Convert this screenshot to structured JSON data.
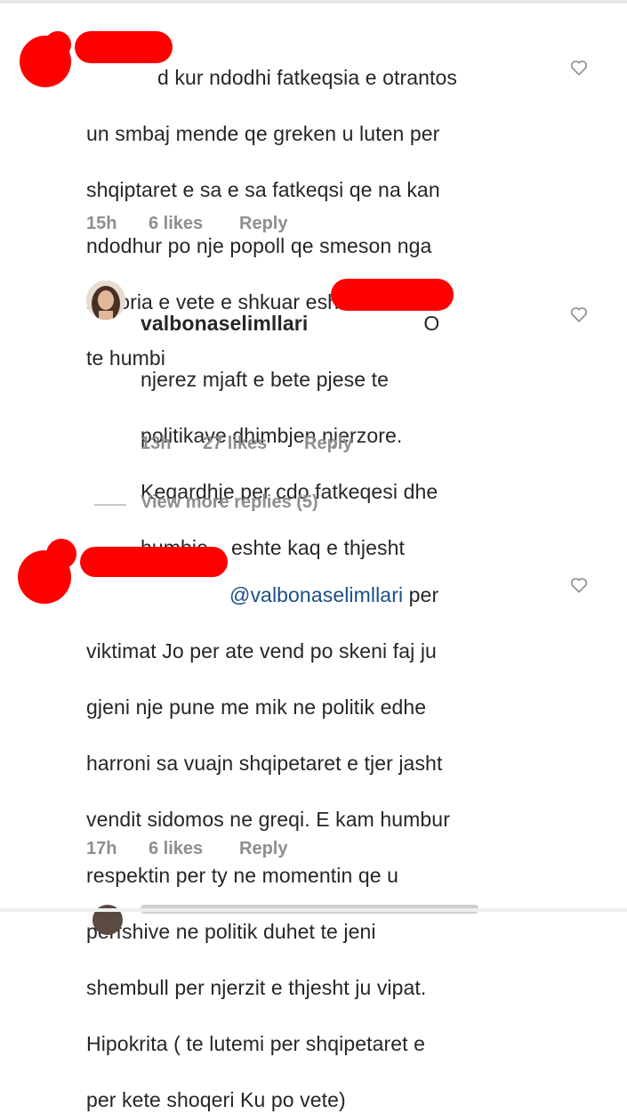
{
  "comments": [
    {
      "username": "",
      "text_lines": [
        "d kur ndodhi fatkeqsia e otrantos",
        "un smbaj mende qe greken u luten per",
        "shqiptaret e sa e sa fatkeqsi qe na kan",
        "ndodhur po nje popoll qe smeson nga",
        "historia e vete e shkuar esht i destinuar",
        "te humbi"
      ],
      "time": "15h",
      "likes": "6 likes",
      "reply": "Reply",
      "redacted": true
    },
    {
      "username": "valbonaselimllari",
      "text_tail": "O",
      "text_lines": [
        "njerez mjaft e bete pjese te",
        "politikave dhimbjen njerzore.",
        "Keqardhje per cdo fatkeqesi dhe",
        "humbje... eshte kaq e thjesht"
      ],
      "time": "13h",
      "likes": "27 likes",
      "reply": "Reply",
      "avatar": "profile-photo"
    },
    {
      "username": "",
      "mention": "@valbonaselimllari",
      "mention_tail": " per",
      "text_lines": [
        "viktimat Jo per ate vend po skeni faj ju",
        "gjeni nje pune me mik ne politik edhe",
        "harroni sa vuajn shqipetaret e tjer jasht",
        "vendit sidomos ne greqi. E kam humbur",
        "respektin per ty ne momentin qe u",
        "perfshive ne politik duhet te jeni",
        "shembull per njerzit e thjesht ju vipat.",
        "Hipokrita ( te lutemi per shqipetaret e",
        "per kete shoqeri Ku po vete)"
      ],
      "time": "17h",
      "likes": "6 likes",
      "reply": "Reply",
      "redacted": true
    }
  ],
  "view_more": "View more replies (5)",
  "icons": {
    "like": "heart-outline-icon"
  },
  "colors": {
    "redaction": "#ff0000",
    "meta": "#8e8e8e",
    "mention": "#1a4f86"
  }
}
